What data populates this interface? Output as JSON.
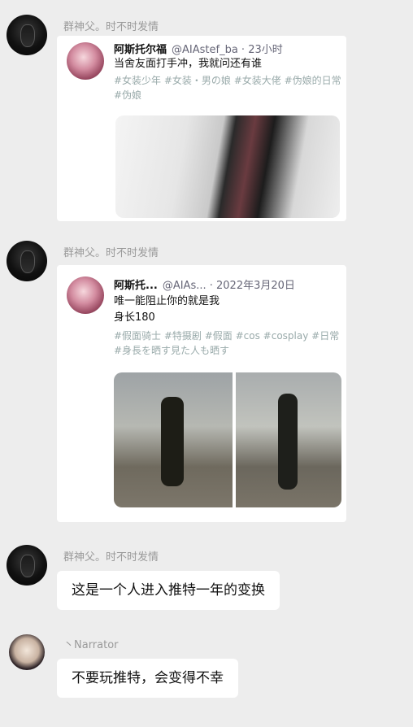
{
  "messages": [
    {
      "sender": "群神父。时不时发情",
      "tweet": {
        "name": "阿斯托尔福",
        "meta": "@AIAstef_ba · 23小时",
        "text": "当舍友面打手冲，我就问还有谁",
        "tags": "#女装少年 #女装・男の娘 #女装大佬 #伪娘的日常 #伪娘"
      }
    },
    {
      "sender": "群神父。时不时发情",
      "tweet": {
        "name": "阿斯托...",
        "meta": "@AIAs... · 2022年3月20日",
        "text_line1": "唯一能阻止你的就是我",
        "text_line2": "身长180",
        "tags": "#假面骑士 #特摄剧 #假面 #cos #cosplay #日常 #身長を晒す見た人も晒す"
      }
    },
    {
      "sender": "群神父。时不时发情",
      "text": "这是一个人进入推特一年的变换"
    },
    {
      "sender": "丶Narrator",
      "text": "不要玩推特，会变得不幸"
    }
  ]
}
